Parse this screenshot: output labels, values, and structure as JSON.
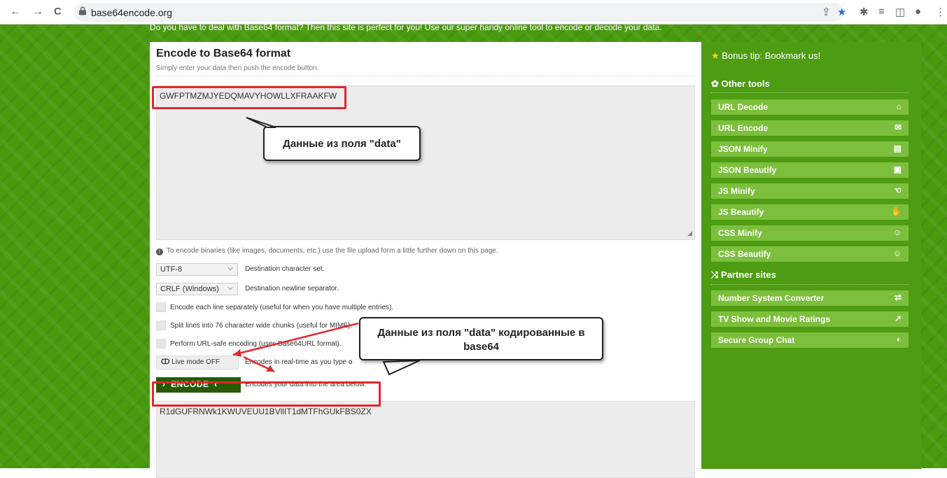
{
  "browser": {
    "url": "base64encode.org",
    "back_icon": "←",
    "forward_icon": "→",
    "reload_icon": "C",
    "share_icon": "⇪",
    "bookmark_icon": "★",
    "extensions_icon": "✱",
    "media_icon": "≡",
    "sidepanel_icon": "◫",
    "profile_icon": "●",
    "menu_icon": "⋮"
  },
  "top_tagline": "Do you have to deal with Base64 format? Then this site is perfect for you! Use our super handy online tool to encode or decode your data.",
  "main": {
    "title": "Encode to Base64 format",
    "subtitle": "Simply enter your data then push the encode button.",
    "input_value": "GWFPTMZMJYEDQMAVYHOWLLXFRAAKFW",
    "hint": "To encode binaries (like images, documents, etc.) use the file upload form a little further down on this page.",
    "charset": {
      "value": "UTF-8",
      "label": "Destination character set."
    },
    "newline": {
      "value": "CRLF (Windows)",
      "label": "Destination newline separator."
    },
    "options": [
      "Encode each line separately (useful for when you have multiple entries).",
      "Split lines into 76 character wide chunks (useful for MIME).",
      "Perform URL-safe encoding (uses Base64URL format)."
    ],
    "live_mode": {
      "label": "Live mode OFF",
      "desc": "Encodes in real-time as you type o"
    },
    "encode_button": "ENCODE",
    "encode_desc": "Encodes your data into the area below.",
    "output_value": "R1dGUFRNWk1KWUVEUU1BVllIT1dMTFhGUkFBS0ZX"
  },
  "callouts": {
    "input": "Данные из поля \"data\"",
    "output_line1": "Данные из поля \"data\" кодированные в",
    "output_line2": "base64"
  },
  "sidebar": {
    "bonus": "Bonus tip: Bookmark us!",
    "other_tools": "Other tools",
    "tools": [
      {
        "label": "URL Decode",
        "icon": "⌂"
      },
      {
        "label": "URL Encode",
        "icon": "✉"
      },
      {
        "label": "JSON Minify",
        "icon": "▤"
      },
      {
        "label": "JSON Beautify",
        "icon": "▣"
      },
      {
        "label": "JS Minify",
        "icon": "☜"
      },
      {
        "label": "JS Beautify",
        "icon": "✋"
      },
      {
        "label": "CSS Minify",
        "icon": "☺"
      },
      {
        "label": "CSS Beautify",
        "icon": "☺"
      }
    ],
    "partner_sites": "Partner sites",
    "partners": [
      {
        "label": "Number System Converter",
        "icon": "⇄"
      },
      {
        "label": "TV Show and Movie Ratings",
        "icon": "↗"
      },
      {
        "label": "Secure Group Chat",
        "icon": "◐"
      }
    ]
  },
  "colors": {
    "page_green": "#4a9a0f",
    "sidebar_item": "#7cbf3c",
    "encode_button": "#285a06",
    "highlight_red": "#e0282e"
  }
}
